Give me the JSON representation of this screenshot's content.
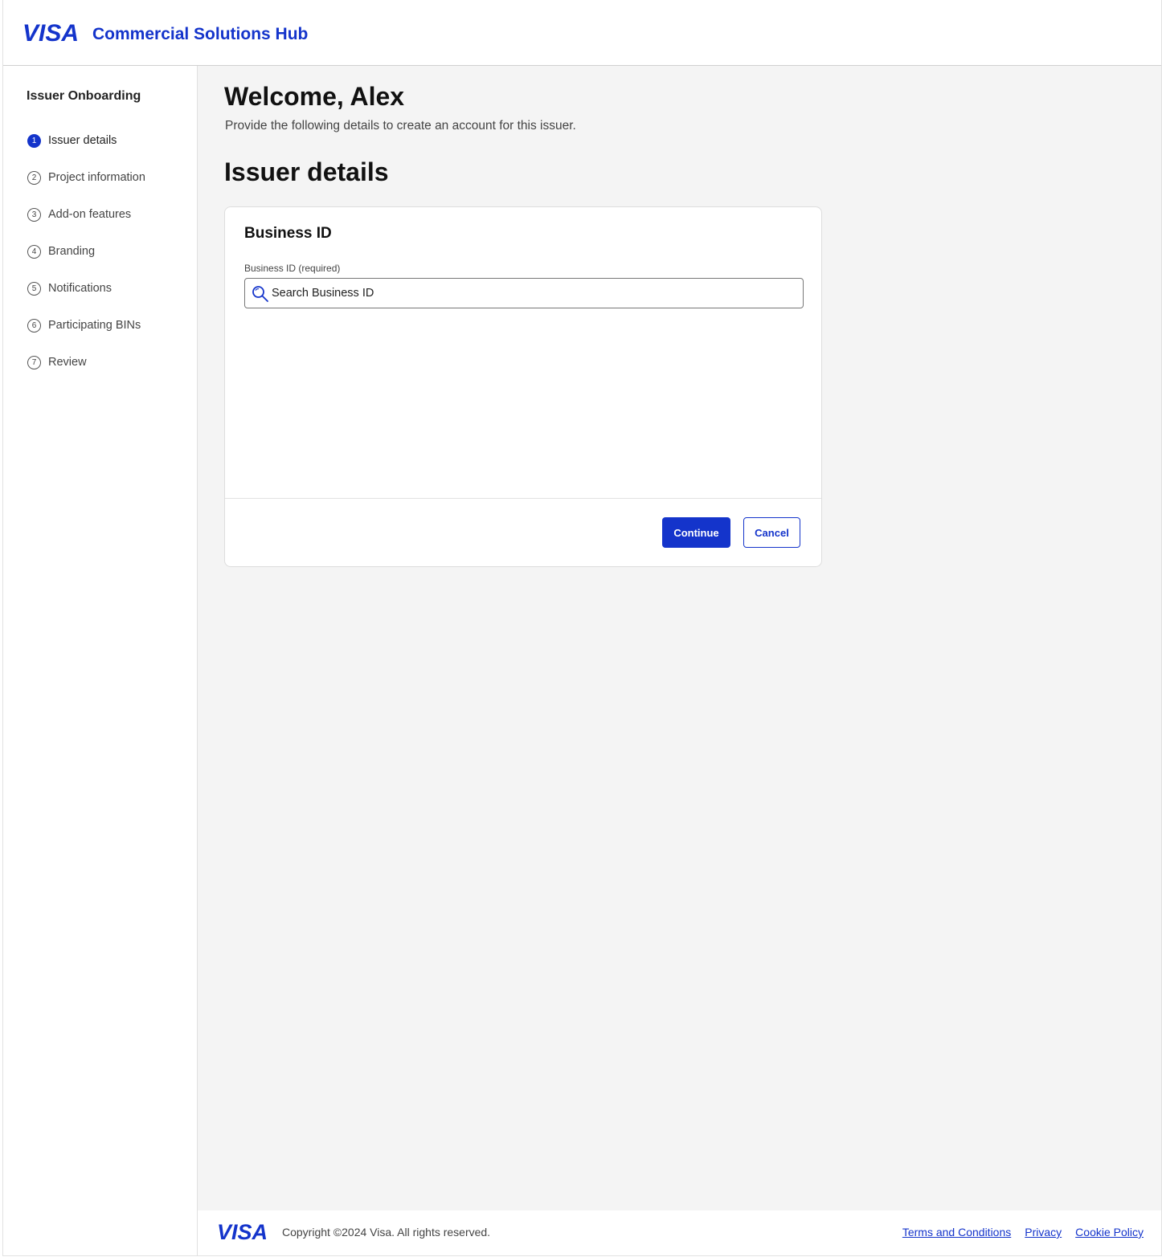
{
  "header": {
    "logo_text": "VISA",
    "app_title": "Commercial Solutions Hub"
  },
  "sidebar": {
    "title": "Issuer Onboarding",
    "steps": [
      {
        "number": "1",
        "label": "Issuer details",
        "active": true
      },
      {
        "number": "2",
        "label": "Project information",
        "active": false
      },
      {
        "number": "3",
        "label": "Add-on features",
        "active": false
      },
      {
        "number": "4",
        "label": "Branding",
        "active": false
      },
      {
        "number": "5",
        "label": "Notifications",
        "active": false
      },
      {
        "number": "6",
        "label": "Participating BINs",
        "active": false
      },
      {
        "number": "7",
        "label": "Review",
        "active": false
      }
    ]
  },
  "main": {
    "welcome": "Welcome, Alex",
    "subtitle": "Provide the following details to create an account for this issuer.",
    "section_title": "Issuer details",
    "card": {
      "title": "Business ID",
      "field_label": "Business ID (required)",
      "search_placeholder": "Search Business ID",
      "search_icon": "search-icon",
      "continue_label": "Continue",
      "cancel_label": "Cancel"
    }
  },
  "footer": {
    "logo_text": "VISA",
    "copyright": "Copyright ©2024 Visa. All rights reserved.",
    "links": [
      "Terms and Conditions",
      "Privacy",
      "Cookie Policy"
    ]
  },
  "colors": {
    "brand_blue": "#1434cb",
    "page_background": "#f4f4f4"
  }
}
